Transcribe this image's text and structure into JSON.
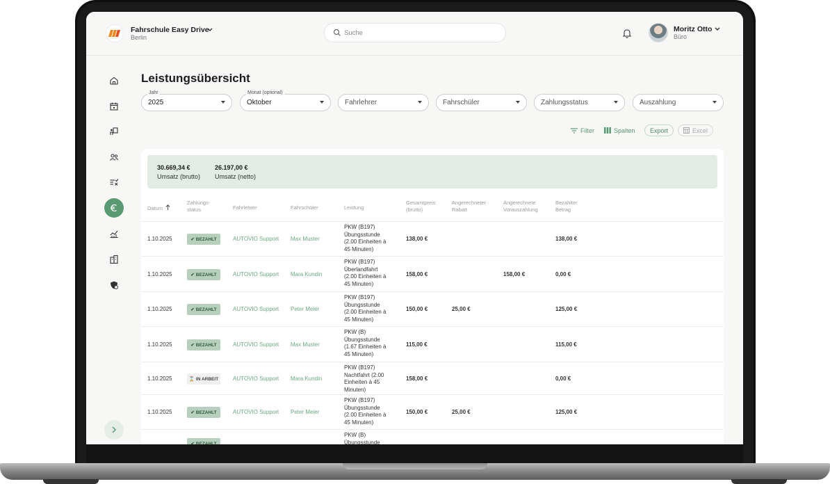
{
  "header": {
    "org_name": "Fahrschule Easy Drive",
    "org_city": "Berlin",
    "search_placeholder": "Suche",
    "user_name": "Moritz Otto",
    "user_role": "Büro"
  },
  "sidebar": {
    "items": [
      "home-icon",
      "calendar-icon",
      "lesson-icon",
      "users-icon",
      "tasks-icon",
      "euro-icon",
      "analytics-icon",
      "building-icon",
      "shield-icon"
    ],
    "active": "euro-icon"
  },
  "page": {
    "title": "Leistungsübersicht"
  },
  "filters": {
    "year_label": "Jahr",
    "year_value": "2025",
    "month_label": "Monat (optional)",
    "month_value": "Oktober",
    "instructor_placeholder": "Fahrlehrer",
    "student_placeholder": "Fahrschüler",
    "payment_status_placeholder": "Zahlungsstatus",
    "payout_placeholder": "Auszahlung"
  },
  "toolbar": {
    "filter": "Filter",
    "columns": "Spalten",
    "export": "Export",
    "excel": "Excel"
  },
  "summary": {
    "gross_value": "30.669,34 €",
    "gross_label": "Umsatz (brutto)",
    "net_value": "26.197,00 €",
    "net_label": "Umsatz (netto)"
  },
  "table": {
    "headers": {
      "date": "Datum",
      "status_1": "Zahlungs-",
      "status_2": "status",
      "instructor": "Fahrlehrer",
      "student": "Fahrschüler",
      "service": "Leistung",
      "total_1": "Gesamtpreis",
      "total_2": "(brutto)",
      "discount_1": "Angerechneter",
      "discount_2": "Rabatt",
      "prepay_1": "Angerechnete",
      "prepay_2": "Vorauszahlung",
      "paid_1": "Bezahlter",
      "paid_2": "Betrag"
    },
    "rows": [
      {
        "date": "1.10.2025",
        "status": "BEZAHLT",
        "instructor": "AUTOVIO Support",
        "student": "Max Muster",
        "service": [
          "PKW (B197)",
          "Übungsstunde",
          "(2.00 Einheiten à",
          "45 Minuten)"
        ],
        "total": "138,00 €",
        "discount": "",
        "prepay": "",
        "paid": "138,00 €"
      },
      {
        "date": "1.10.2025",
        "status": "BEZAHLT",
        "instructor": "AUTOVIO Support",
        "student": "Mara Kundin",
        "service": [
          "PKW (B197)",
          "Überlandfahrt",
          "(2.00 Einheiten à",
          "45 Minuten)"
        ],
        "total": "158,00 €",
        "discount": "",
        "prepay": "158,00 €",
        "paid": "0,00 €"
      },
      {
        "date": "1.10.2025",
        "status": "BEZAHLT",
        "instructor": "AUTOVIO Support",
        "student": "Peter Meier",
        "service": [
          "PKW (B197)",
          "Übungsstunde",
          "(2.00 Einheiten à",
          "45 Minuten)"
        ],
        "total": "150,00 €",
        "discount": "25,00 €",
        "prepay": "",
        "paid": "125,00 €"
      },
      {
        "date": "1.10.2025",
        "status": "BEZAHLT",
        "instructor": "AUTOVIO Support",
        "student": "Max Muster",
        "service": [
          "PKW (B)",
          "Übungsstunde",
          "(1.67 Einheiten à",
          "45 Minuten)"
        ],
        "total": "115,00 €",
        "discount": "",
        "prepay": "",
        "paid": "115,00 €"
      },
      {
        "date": "1.10.2025",
        "status": "IN ARBEIT",
        "instructor": "AUTOVIO Support",
        "student": "Mara Kundin",
        "service": [
          "PKW (B197)",
          "Nachtfahrt (2.00",
          "Einheiten à 45",
          "Minuten)"
        ],
        "total": "158,00 €",
        "discount": "",
        "prepay": "",
        "paid": "0,00 €"
      },
      {
        "date": "1.10.2025",
        "status": "BEZAHLT",
        "instructor": "AUTOVIO Support",
        "student": "Peter Meier",
        "service": [
          "PKW (B197)",
          "Übungsstunde",
          "(2.00 Einheiten à",
          "45 Minuten)"
        ],
        "total": "150,00 €",
        "discount": "25,00 €",
        "prepay": "",
        "paid": "125,00 €"
      },
      {
        "date": "",
        "status": "BEZAHLT",
        "instructor": "",
        "student": "",
        "service": [
          "PKW (B)",
          "Übungsstunde"
        ],
        "total": "",
        "discount": "",
        "prepay": "",
        "paid": ""
      }
    ]
  },
  "colors": {
    "accent": "#5a9a73",
    "summary_bg": "#e3ebe5",
    "badge_paid": "#b7d0be"
  }
}
